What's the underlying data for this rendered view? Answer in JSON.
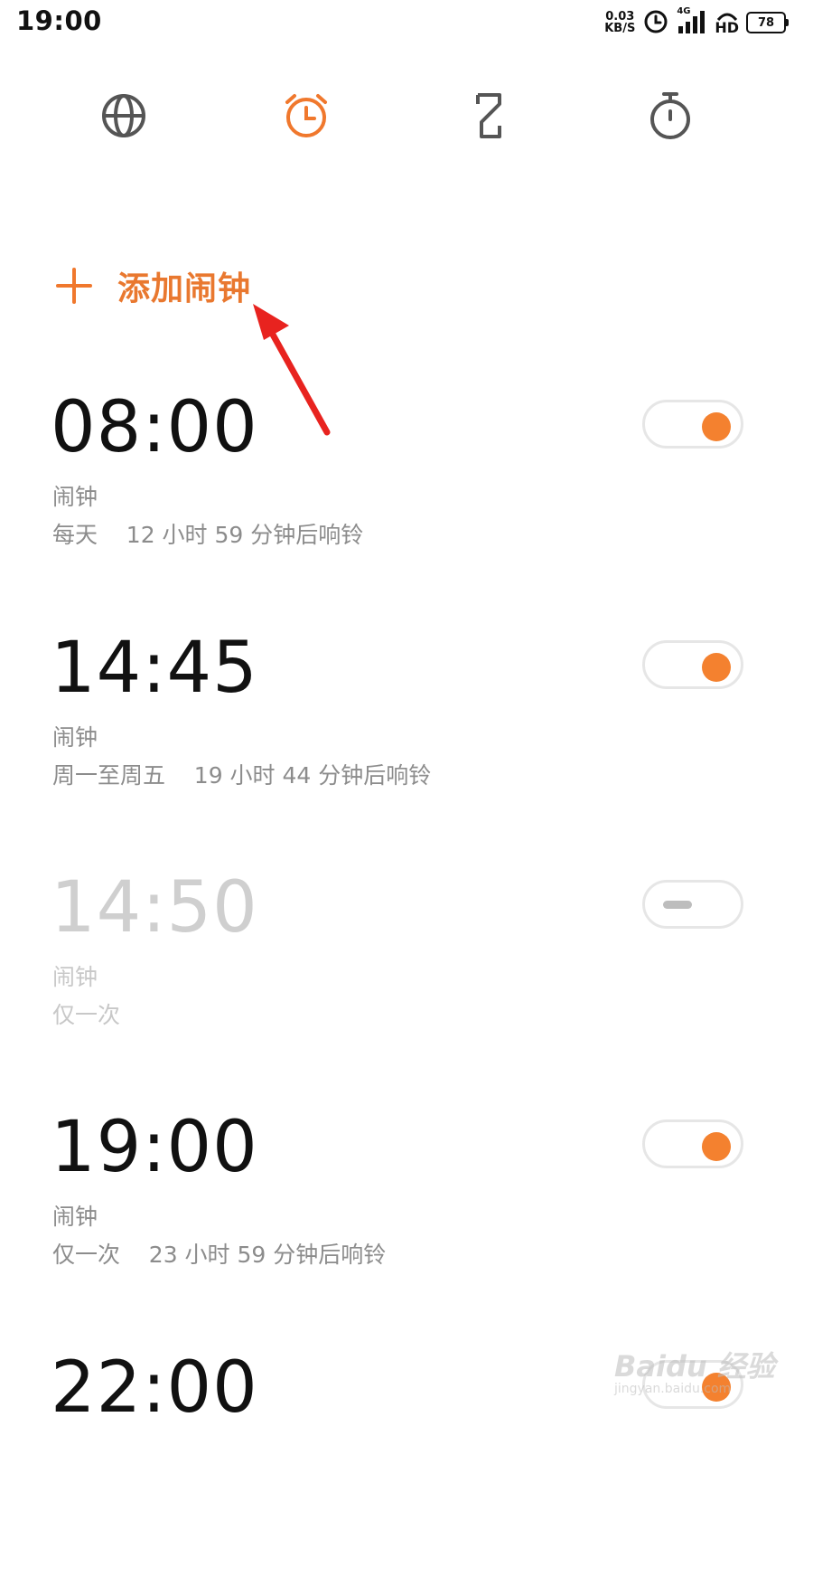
{
  "status_bar": {
    "time": "19:00",
    "net_speed_value": "0.03",
    "net_speed_unit": "KB/S",
    "network_type": "4G",
    "hd_label": "HD",
    "battery_level": "78",
    "icons": [
      "alarm-status-icon",
      "signal-icon",
      "hd-call-icon",
      "battery-icon"
    ]
  },
  "tabs": [
    {
      "name": "world-clock",
      "icon": "globe-icon",
      "active": false
    },
    {
      "name": "alarm",
      "icon": "alarm-clock-icon",
      "active": true
    },
    {
      "name": "timer",
      "icon": "hourglass-icon",
      "active": false
    },
    {
      "name": "stopwatch",
      "icon": "stopwatch-icon",
      "active": false
    }
  ],
  "accent_color": "#f0782d",
  "add_alarm": {
    "label": "添加闹钟"
  },
  "alarms": [
    {
      "time": "08:00",
      "label": "闹钟",
      "repeat": "每天    12 小时 59 分钟后响铃",
      "enabled": true
    },
    {
      "time": "14:45",
      "label": "闹钟",
      "repeat": "周一至周五    19 小时 44 分钟后响铃",
      "enabled": true
    },
    {
      "time": "14:50",
      "label": "闹钟",
      "repeat": "仅一次",
      "enabled": false
    },
    {
      "time": "19:00",
      "label": "闹钟",
      "repeat": "仅一次    23 小时 59 分钟后响铃",
      "enabled": true
    },
    {
      "time": "22:00",
      "label": "",
      "repeat": "",
      "enabled": true
    }
  ],
  "watermark": {
    "brand": "Baidu 经验",
    "url": "jingyan.baidu.com"
  }
}
